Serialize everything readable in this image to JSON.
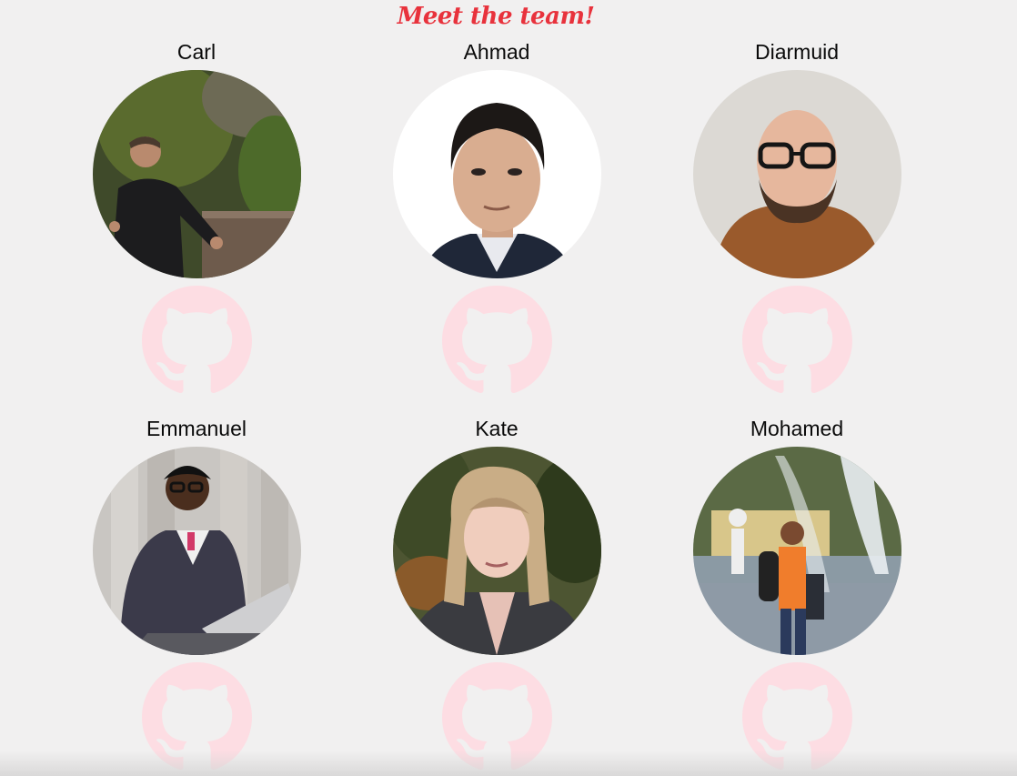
{
  "header": {
    "title": "Meet the team!"
  },
  "team": [
    {
      "name": "Carl",
      "github_icon": "github-icon"
    },
    {
      "name": "Ahmad",
      "github_icon": "github-icon"
    },
    {
      "name": "Diarmuid",
      "github_icon": "github-icon"
    },
    {
      "name": "Emmanuel",
      "github_icon": "github-icon"
    },
    {
      "name": "Kate",
      "github_icon": "github-icon"
    },
    {
      "name": "Mohamed",
      "github_icon": "github-icon"
    }
  ],
  "colors": {
    "background": "#f1f0f0",
    "title": "#e8323c",
    "github_icon": "#fddde3",
    "name_text": "#0a0a0a"
  }
}
